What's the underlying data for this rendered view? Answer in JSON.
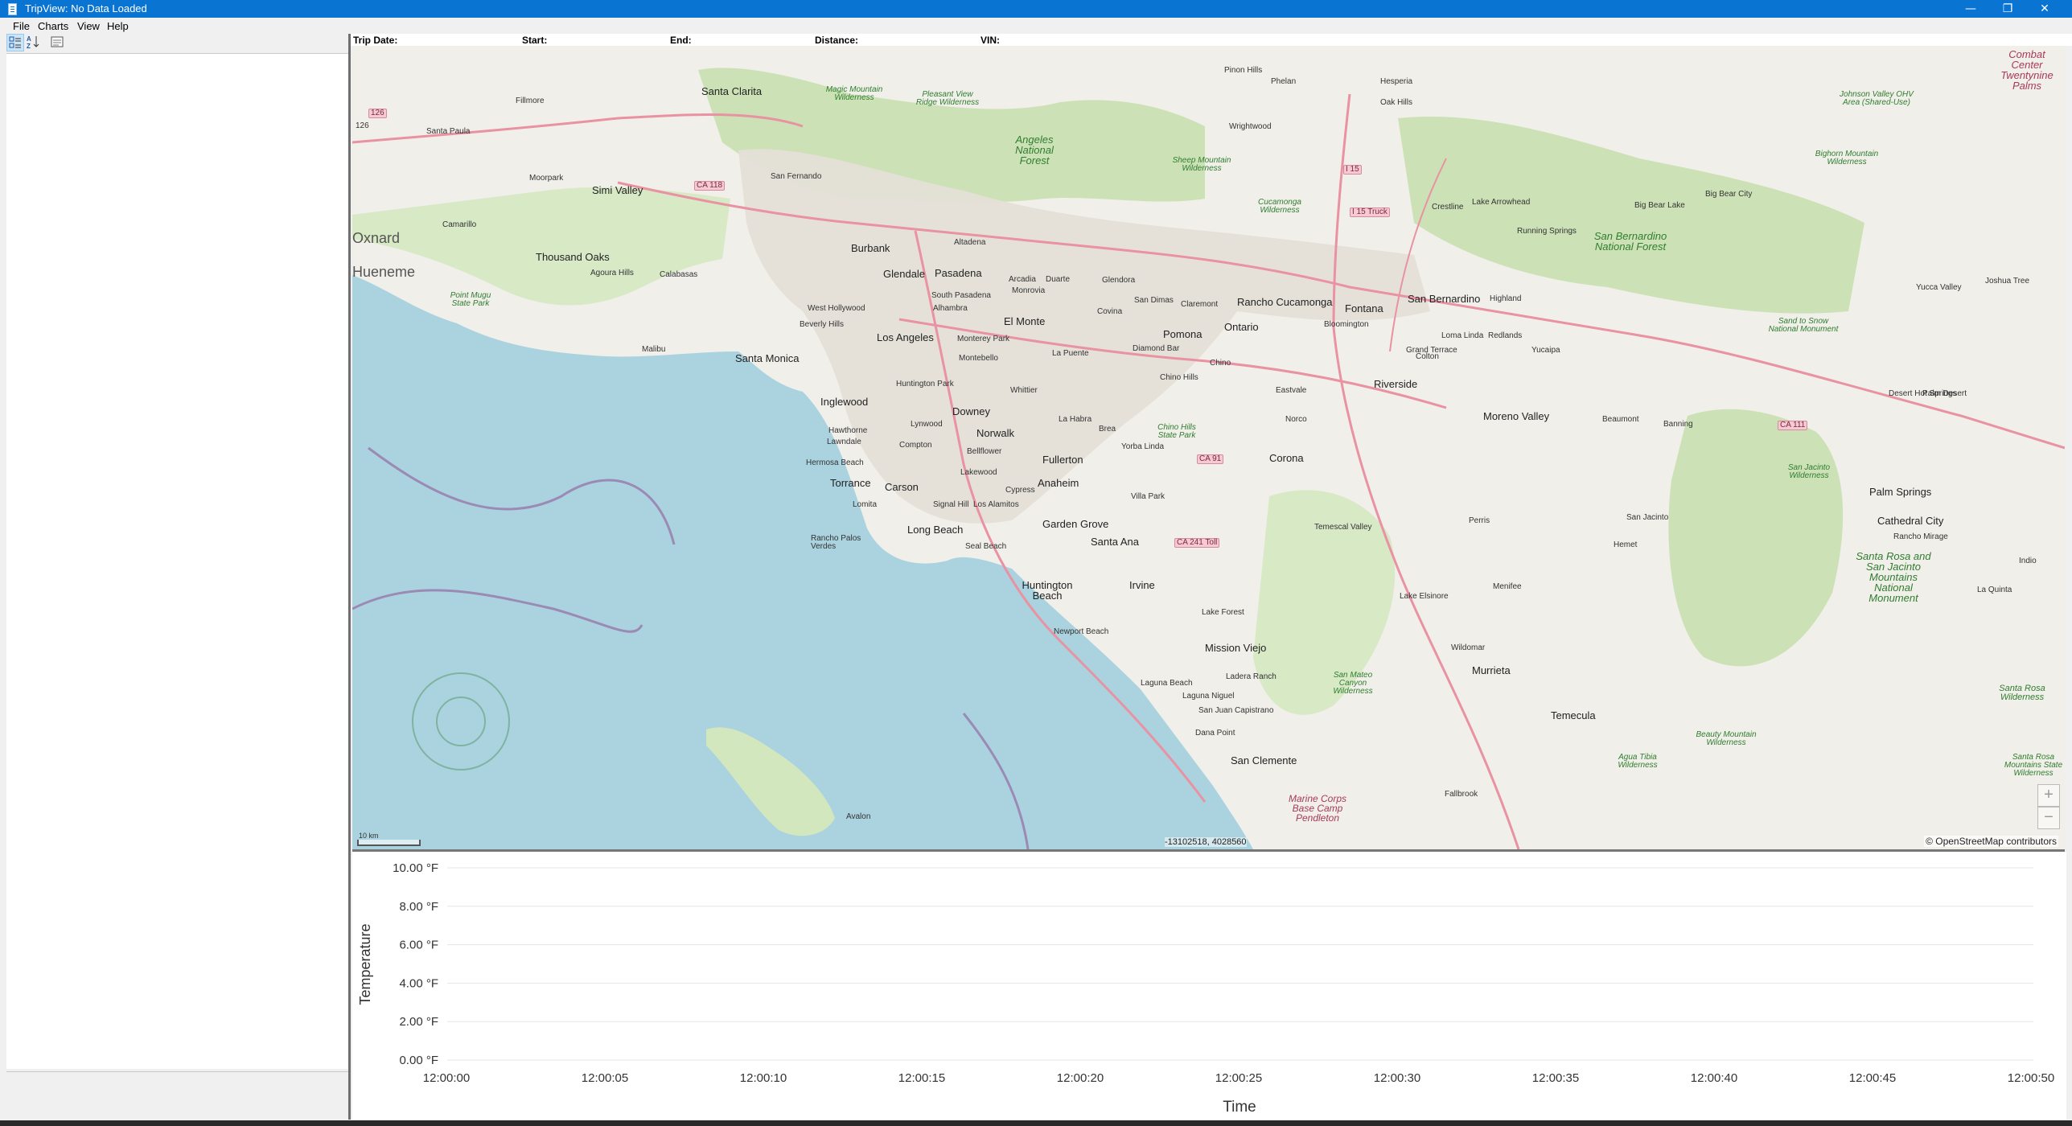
{
  "window": {
    "title": "TripView: No Data Loaded",
    "controls": {
      "minimize": "—",
      "restore": "❐",
      "close": "✕"
    }
  },
  "menu": {
    "items": [
      "File",
      "Charts",
      "View",
      "Help"
    ]
  },
  "toolbar": {
    "buttons": [
      {
        "icon": "categorized-view-icon",
        "pressed": true
      },
      {
        "icon": "sort-alphabetical-icon",
        "pressed": false
      },
      {
        "icon": "property-pages-icon",
        "pressed": false
      }
    ]
  },
  "trip_info": {
    "trip_date_label": "Trip Date:",
    "start_label": "Start:",
    "end_label": "End:",
    "distance_label": "Distance:",
    "vin_label": "VIN:"
  },
  "map": {
    "scale_label": "10 km",
    "coordinates": "-13102518, 4028560",
    "attribution": "© OpenStreetMap contributors",
    "zoom_in": "+",
    "zoom_out": "−",
    "colors": {
      "land": "#f1efe9",
      "water": "#aad3df",
      "forest": "#c8e0b0",
      "park_border": "#7fb37f",
      "motorway": "#e892a2",
      "urban": "#e4dfd8"
    },
    "labels": {
      "cities": [
        "Santa Clarita",
        "Los Angeles",
        "Santa Monica",
        "Inglewood",
        "Torrance",
        "Long Beach",
        "Downey",
        "Norwalk",
        "Fullerton",
        "Anaheim",
        "Garden Grove",
        "Santa Ana",
        "Huntington Beach",
        "Irvine",
        "Mission Viejo",
        "San Clemente",
        "Temecula",
        "Murrieta",
        "Moreno Valley",
        "Riverside",
        "Corona",
        "Ontario",
        "Pomona",
        "Rancho Cucamonga",
        "Fontana",
        "San Bernardino",
        "Pasadena",
        "Glendale",
        "Burbank",
        "El Monte",
        "Thousand Oaks",
        "Simi Valley",
        "Carson",
        "Palm Springs",
        "Cathedral City",
        "Palm Desert",
        "Oxnard",
        "Hueneme"
      ],
      "towns": [
        "Fillmore",
        "Santa Paula",
        "Moorpark",
        "Camarillo",
        "Agoura Hills",
        "Calabasas",
        "Malibu",
        "San Fernando",
        "Altadena",
        "Arcadia",
        "Monrovia",
        "Duarte",
        "Glendora",
        "Covina",
        "San Dimas",
        "Claremont",
        "Whittier",
        "La Habra",
        "Brea",
        "Yorba Linda",
        "Chino",
        "Chino Hills",
        "Norco",
        "Eastvale",
        "Hawthorne",
        "Lawndale",
        "Hermosa Beach",
        "Compton",
        "Lynwood",
        "Lakewood",
        "Cypress",
        "Los Alamitos",
        "Seal Beach",
        "Signal Hill",
        "Lomita",
        "Rancho Palos Verdes",
        "Newport Beach",
        "Laguna Beach",
        "Laguna Niguel",
        "San Juan Capistrano",
        "Dana Point",
        "Lake Forest",
        "Ladera Ranch",
        "Villa Park",
        "Lake Elsinore",
        "Wildomar",
        "Menifee",
        "Perris",
        "Hemet",
        "San Jacinto",
        "Beaumont",
        "Banning",
        "Yucaipa",
        "Redlands",
        "Loma Linda",
        "Colton",
        "Highland",
        "Grand Terrace",
        "Bloomington",
        "Crestline",
        "Lake Arrowhead",
        "Running Springs",
        "Big Bear Lake",
        "Big Bear City",
        "Wrightwood",
        "Phelan",
        "Pinon Hills",
        "Hesperia",
        "Oak Hills",
        "Yucca Valley",
        "Joshua Tree",
        "Desert Hot Springs",
        "Rancho Mirage",
        "Indio",
        "La Quinta",
        "Avalon",
        "West Hollywood",
        "Beverly Hills",
        "South Pasadena",
        "Alhambra",
        "Monterey Park",
        "Montebello",
        "Huntington Park",
        "La Puente",
        "Diamond Bar",
        "Bellflower",
        "Temescal Valley",
        "Fallbrook"
      ],
      "parks": [
        "Angeles National Forest",
        "San Bernardino National Forest",
        "Santa Rosa and San Jacinto Mountains National Monument",
        "Sand to Snow National Monument",
        "Sheep Mountain Wilderness",
        "Cucamonga Wilderness",
        "Magic Mountain Wilderness",
        "Pleasant View Ridge Wilderness",
        "Point Mugu State Park",
        "Chino Hills State Park",
        "San Mateo Canyon Wilderness",
        "Santa Rosa Wilderness",
        "Johnson Valley OHV Area (Shared-Use)",
        "Bighorn Mountain Wilderness",
        "San Jacinto Wilderness",
        "Agua Tibia Wilderness",
        "Beauty Mountain Wilderness",
        "Santa Rosa Mountains State Wilderness"
      ],
      "military": [
        "Combat Center Twentynine Palms",
        "Marine Corps Base Camp Pendleton"
      ],
      "roads": [
        "126",
        "CA 118",
        "I 15",
        "I 15 Truck",
        "CA 91",
        "CA 241 Toll",
        "CA 111"
      ]
    }
  },
  "chart_data": {
    "type": "line",
    "title": "",
    "xlabel": "Time",
    "ylabel": "Temperature",
    "x_ticks": [
      "12:00:00",
      "12:00:05",
      "12:00:10",
      "12:00:15",
      "12:00:20",
      "12:00:25",
      "12:00:30",
      "12:00:35",
      "12:00:40",
      "12:00:45",
      "12:00:50"
    ],
    "y_ticks": [
      "0.00 °F",
      "2.00 °F",
      "4.00 °F",
      "6.00 °F",
      "8.00 °F",
      "10.00 °F"
    ],
    "ylim": [
      0,
      10
    ],
    "xlim": [
      "12:00:00",
      "12:00:50"
    ],
    "series": [],
    "grid": true,
    "legend": "none"
  }
}
